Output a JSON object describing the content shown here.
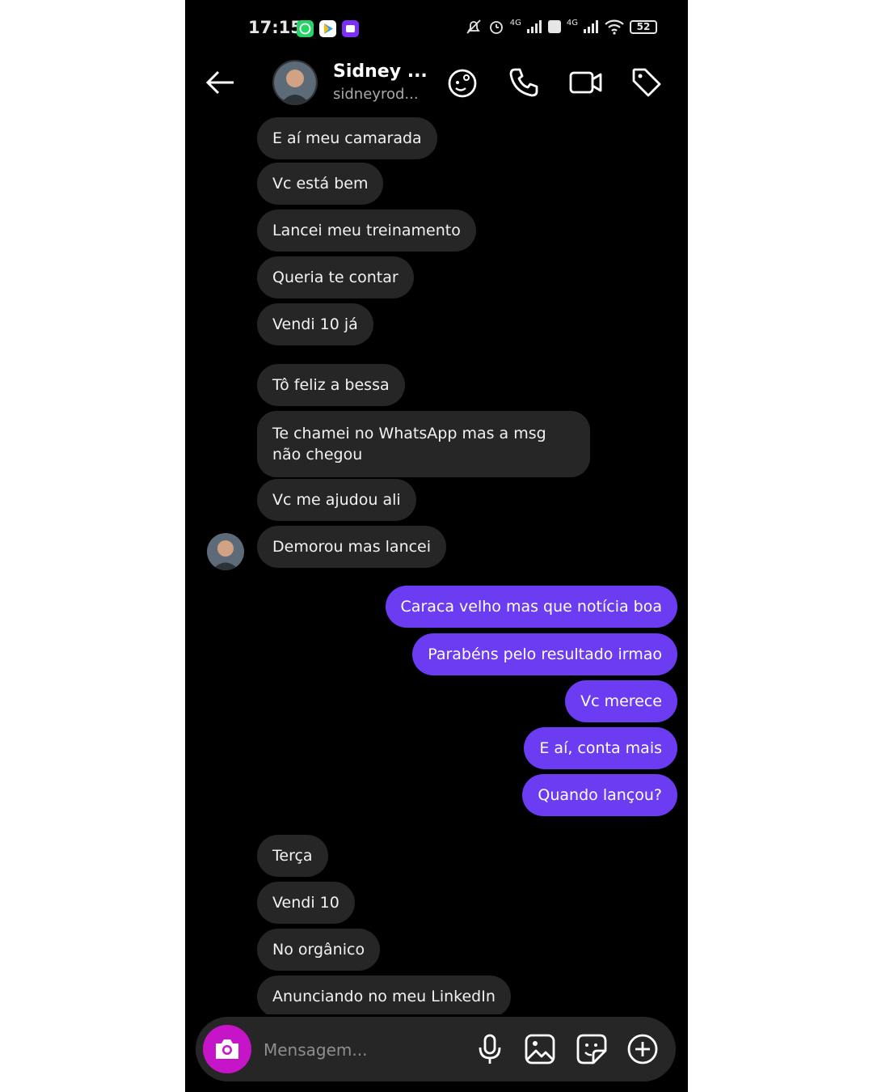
{
  "status_bar": {
    "time": "17:15",
    "signal_1": "4G",
    "signal_2": "4G",
    "battery": "52"
  },
  "header": {
    "name": "Sidney ...",
    "handle": "sidneyrod..."
  },
  "messages": [
    {
      "from": "them",
      "text": "E aí meu camarada"
    },
    {
      "from": "them",
      "text": "Vc está bem"
    },
    {
      "from": "them",
      "text": "Lancei meu treinamento"
    },
    {
      "from": "them",
      "text": "Queria te contar"
    },
    {
      "from": "them",
      "text": "Vendi 10 já"
    },
    {
      "from": "them",
      "text": "Tô feliz a bessa"
    },
    {
      "from": "them",
      "text": "Te chamei no WhatsApp mas a msg não chegou"
    },
    {
      "from": "them",
      "text": "Vc me ajudou ali"
    },
    {
      "from": "them",
      "text": "Demorou mas lancei"
    },
    {
      "from": "me",
      "text": "Caraca velho mas que notícia boa"
    },
    {
      "from": "me",
      "text": "Parabéns pelo resultado irmao"
    },
    {
      "from": "me",
      "text": "Vc merece"
    },
    {
      "from": "me",
      "text": "E aí, conta mais"
    },
    {
      "from": "me",
      "text": "Quando lançou?"
    },
    {
      "from": "them",
      "text": "Terça"
    },
    {
      "from": "them",
      "text": "Vendi 10"
    },
    {
      "from": "them",
      "text": "No orgânico"
    },
    {
      "from": "them",
      "text": "Anunciando no meu LinkedIn"
    }
  ],
  "composer": {
    "placeholder": "Mensagem..."
  },
  "colors": {
    "background": "#000000",
    "incoming_bubble": "#262626",
    "outgoing_bubble": "#6b3cf2",
    "camera_button": "#c614c9"
  },
  "icons": [
    "back-arrow-icon",
    "effects-icon",
    "phone-icon",
    "video-icon",
    "tag-icon",
    "camera-icon",
    "microphone-icon",
    "gallery-icon",
    "sticker-icon",
    "plus-icon"
  ]
}
